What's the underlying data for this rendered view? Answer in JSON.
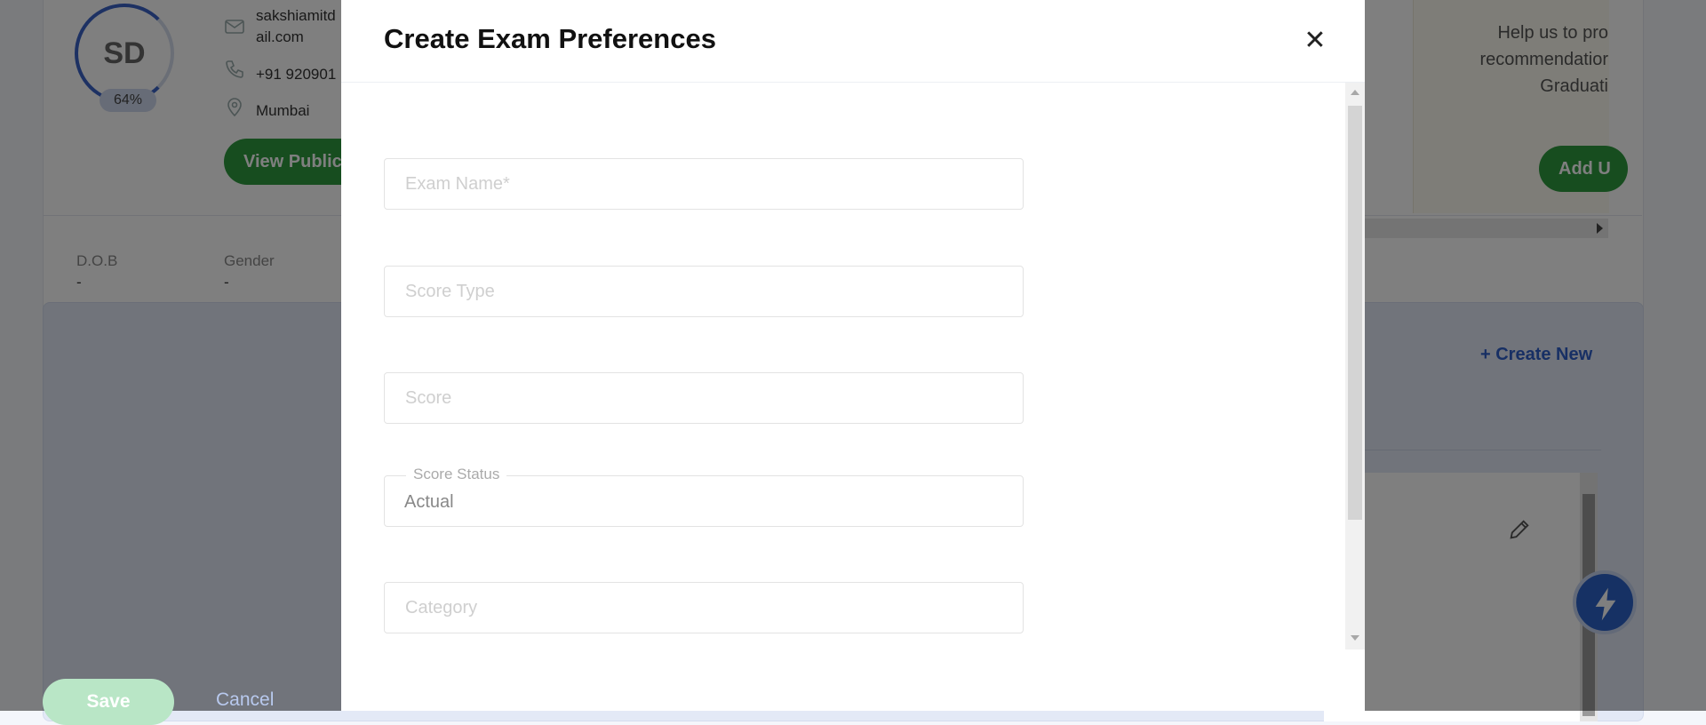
{
  "background": {
    "profile": {
      "initials": "SD",
      "completion": "64%",
      "email_line1": "sakshiamitd",
      "email_line2": "ail.com",
      "phone": "+91 920901",
      "city": "Mumbai",
      "view_public_label": "View Public",
      "dob_label": "D.O.B",
      "dob_value": "-",
      "gender_label": "Gender",
      "gender_value": "-"
    },
    "info_panel": {
      "text": "Help us to pro\nrecommendatior\nGraduati",
      "add_label": "Add U"
    },
    "exam_section": {
      "create_new_label": "+ Create New"
    }
  },
  "modal": {
    "title": "Create Exam Preferences",
    "close_glyph": "✕",
    "fields": {
      "exam_name_placeholder": "Exam Name*",
      "score_type_placeholder": "Score Type",
      "score_placeholder": "Score",
      "score_status_label": "Score Status",
      "score_status_value": "Actual",
      "category_placeholder": "Category"
    },
    "save_label": "Save",
    "cancel_label": "Cancel"
  },
  "colors": {
    "primary_green": "#2e9a3f",
    "accent_blue": "#2f5fc9",
    "save_disabled": "#b9e6c6"
  },
  "icons": [
    "mail-icon",
    "phone-icon",
    "location-icon",
    "edit-icon",
    "lightning-icon",
    "close-icon"
  ]
}
